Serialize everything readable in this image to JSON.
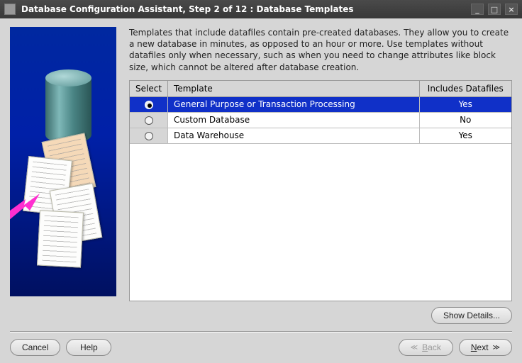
{
  "window": {
    "title": "Database Configuration Assistant, Step 2 of 12 : Database Templates"
  },
  "intro": "Templates that include datafiles contain pre-created databases. They allow you to create a new database in minutes, as opposed to an hour or more. Use templates without datafiles only when necessary, such as when you need to change attributes like block size, which cannot be altered after database creation.",
  "table": {
    "headers": {
      "select": "Select",
      "template": "Template",
      "includes": "Includes Datafiles"
    },
    "rows": [
      {
        "template": "General Purpose or Transaction Processing",
        "includes": "Yes",
        "selected": true
      },
      {
        "template": "Custom Database",
        "includes": "No",
        "selected": false
      },
      {
        "template": "Data Warehouse",
        "includes": "Yes",
        "selected": false
      }
    ]
  },
  "buttons": {
    "show_details": "Show Details...",
    "cancel": "Cancel",
    "help": "Help",
    "back": "Back",
    "next": "Next"
  },
  "icons": {
    "minimize": "_",
    "maximize": "□",
    "close": "×",
    "chev_left": "≪",
    "chev_right": "≫"
  }
}
